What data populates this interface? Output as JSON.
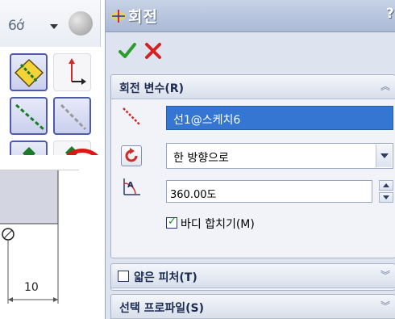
{
  "panel": {
    "title": "회전",
    "help": "?",
    "ok_icon": "checkmark-icon",
    "cancel_icon": "x-icon",
    "groups": {
      "params": {
        "title": "회전 변수(R)",
        "axis_value": "선1@스케치6",
        "direction_value": "한 방향으로",
        "angle_value": "360.00도",
        "merge_label": "바디 합치기(M)",
        "merge_checked": true
      },
      "thin": {
        "title": "얇은 피처(T)",
        "checked": false
      },
      "profile": {
        "title": "선택 프로파일(S)"
      }
    }
  },
  "drawing": {
    "dimension": "10"
  },
  "colors": {
    "accent_red": "#e21414",
    "selection_blue": "#3476d2",
    "panel_bg": "#dee4ef"
  }
}
